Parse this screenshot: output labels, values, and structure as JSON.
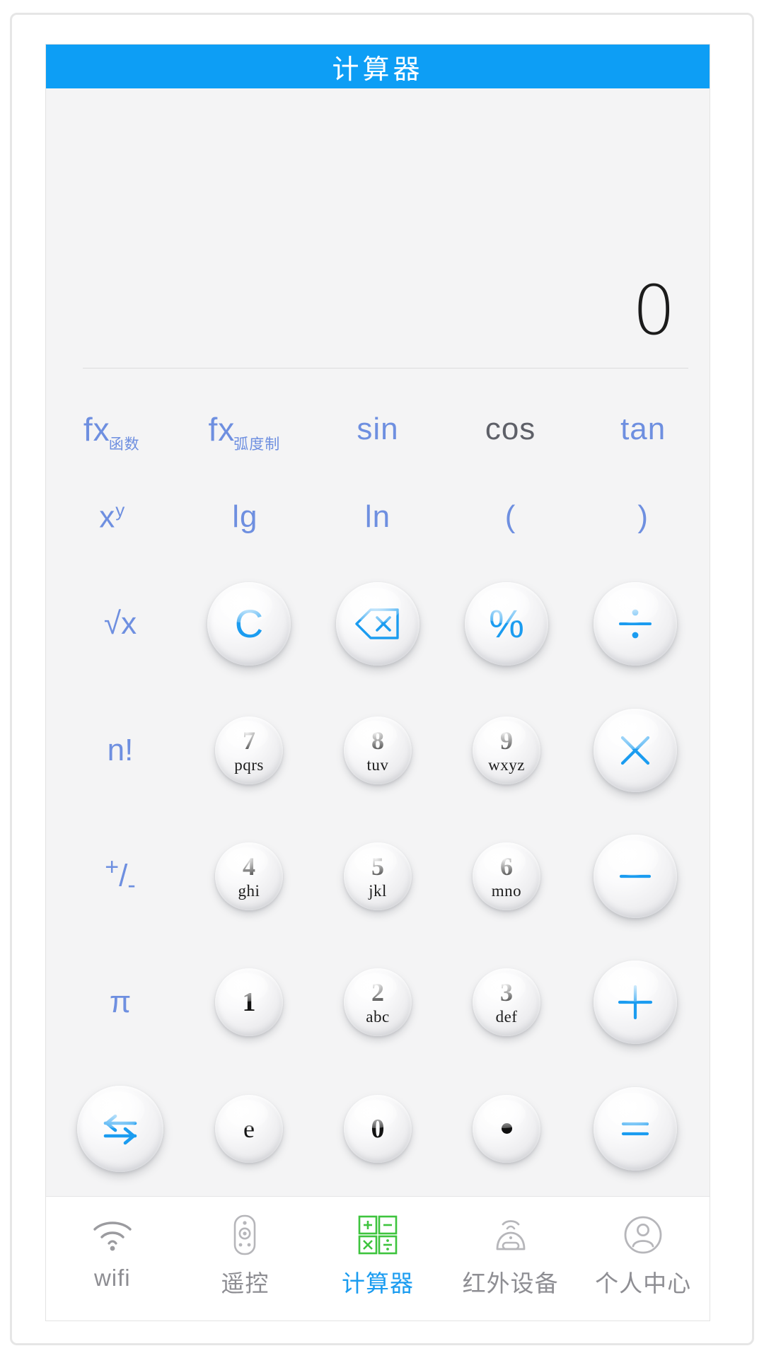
{
  "header": {
    "title": "计算器"
  },
  "display": {
    "value": "0"
  },
  "function_rows": [
    [
      {
        "name": "fx-function",
        "main": "fx",
        "sub": "函数",
        "type": "fx"
      },
      {
        "name": "fx-radian",
        "main": "fx",
        "sub": "弧度制",
        "type": "fx"
      },
      {
        "name": "sin",
        "label": "sin",
        "type": "plain"
      },
      {
        "name": "cos",
        "label": "cos",
        "type": "plain"
      },
      {
        "name": "tan",
        "label": "tan",
        "type": "plain"
      }
    ],
    [
      {
        "name": "x-power-y",
        "label": "x",
        "sup": "y",
        "type": "sup"
      },
      {
        "name": "lg",
        "label": "lg",
        "type": "plain"
      },
      {
        "name": "ln",
        "label": "ln",
        "type": "plain"
      },
      {
        "name": "paren-open",
        "label": "(",
        "type": "plain"
      },
      {
        "name": "paren-close",
        "label": ")",
        "type": "plain"
      }
    ]
  ],
  "keypad": {
    "left_labels": {
      "sqrt": "√x",
      "factorial": "n!",
      "plus_minus_top": "+",
      "plus_minus_slash": "/",
      "plus_minus_bottom": "-",
      "pi": "π"
    },
    "operators": {
      "clear": "C",
      "backspace": "backspace-icon",
      "percent": "%",
      "divide": "÷",
      "multiply": "×",
      "minus": "—",
      "plus": "+",
      "equals": "=",
      "swap": "swap-icon"
    },
    "numbers": [
      {
        "digit": "7",
        "letters": "pqrs"
      },
      {
        "digit": "8",
        "letters": "tuv"
      },
      {
        "digit": "9",
        "letters": "wxyz"
      },
      {
        "digit": "4",
        "letters": "ghi"
      },
      {
        "digit": "5",
        "letters": "jkl"
      },
      {
        "digit": "6",
        "letters": "mno"
      },
      {
        "digit": "1",
        "letters": ""
      },
      {
        "digit": "2",
        "letters": "abc"
      },
      {
        "digit": "3",
        "letters": "def"
      },
      {
        "digit": "e",
        "letters": ""
      },
      {
        "digit": "0",
        "letters": ""
      },
      {
        "digit": ".",
        "letters": ""
      }
    ]
  },
  "bottom_nav": {
    "items": [
      {
        "label": "wifi",
        "icon": "wifi-icon",
        "active": false
      },
      {
        "label": "遥控",
        "icon": "remote-icon",
        "active": false
      },
      {
        "label": "计算器",
        "icon": "calculator-icon",
        "active": true
      },
      {
        "label": "红外设备",
        "icon": "infrared-icon",
        "active": false
      },
      {
        "label": "个人中心",
        "icon": "user-icon",
        "active": false
      }
    ]
  },
  "colors": {
    "header_blue": "#0d9ef5",
    "accent_blue": "#1b9cf0",
    "label_blue": "#6e8fe0",
    "nav_active": "#1b9cf0",
    "nav_inactive": "#8e8e93",
    "calc_icon_green": "#3ec43e",
    "panel_bg": "#f4f4f5"
  }
}
